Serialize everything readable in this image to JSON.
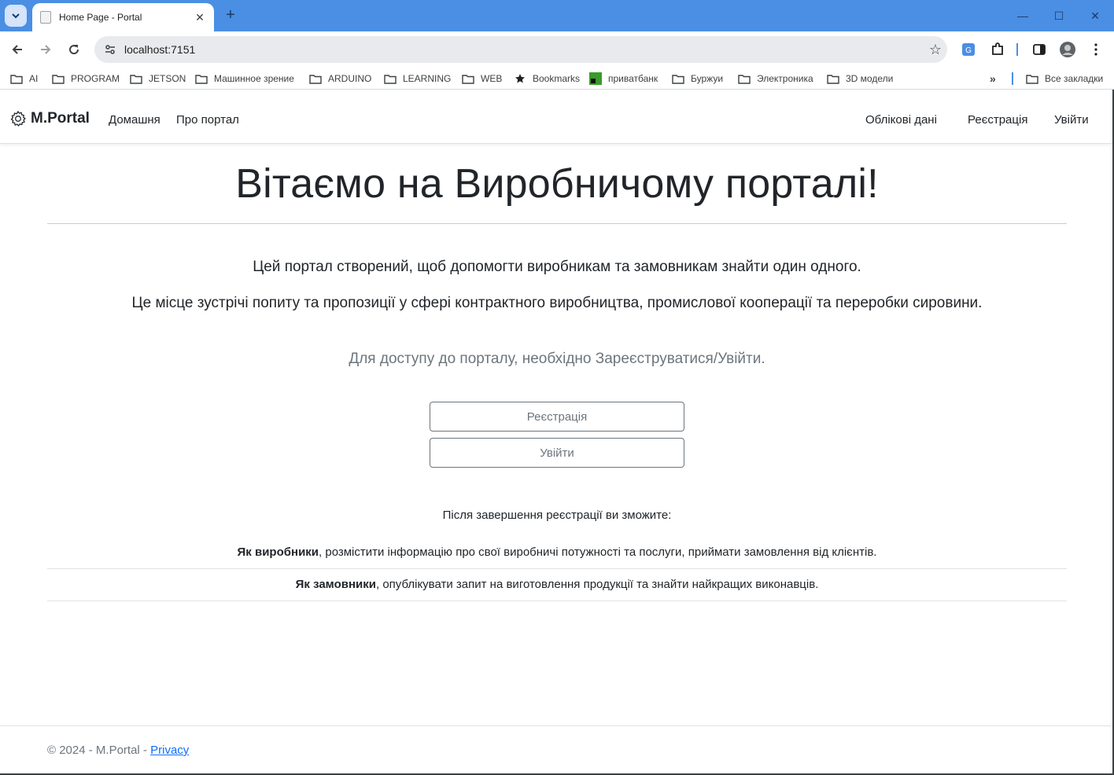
{
  "browser": {
    "tab_title": "Home Page - Portal",
    "url": "localhost:7151",
    "bookmarks": [
      "AI",
      "PROGRAM",
      "JETSON",
      "Машинное зрение",
      "ARDUINO",
      "LEARNING",
      "WEB",
      "Bookmarks",
      "приватбанк",
      "Буржуи",
      "Электроника",
      "3D модели"
    ],
    "all_bookmarks": "Все закладки",
    "accent_color": "#4a8fe3"
  },
  "navbar": {
    "brand": "M.Portal",
    "left_links": [
      "Домашня",
      "Про портал"
    ],
    "right_links": [
      "Облікові дані",
      "Реєстрація",
      "Увійти"
    ]
  },
  "main": {
    "title": "Вітаємо на Виробничому порталі!",
    "lead1": "Цей портал створений, щоб допомогти виробникам та замовникам знайти один одного.",
    "lead2": "Це місце зустрічі попиту та пропозиції у сфері контрактного виробництва, промислової кооперації та переробки сировини.",
    "access_text": "Для доступу до порталу, необхідно Зареєструватися/Увійти.",
    "register_button": "Реєстрація",
    "login_button": "Увійти",
    "after_text": "Після завершення реєстрації ви зможите:",
    "features": [
      {
        "bold": "Як виробники",
        "text": ", розмістити інформацію про свої виробничі потужності та послуги, приймати замовлення від клієнтів."
      },
      {
        "bold": "Як замовники",
        "text": ", опублікувати запит на виготовлення продукції та знайти найкращих виконавців."
      }
    ]
  },
  "footer": {
    "copyright": "© 2024 - M.Portal - ",
    "privacy": "Privacy"
  }
}
